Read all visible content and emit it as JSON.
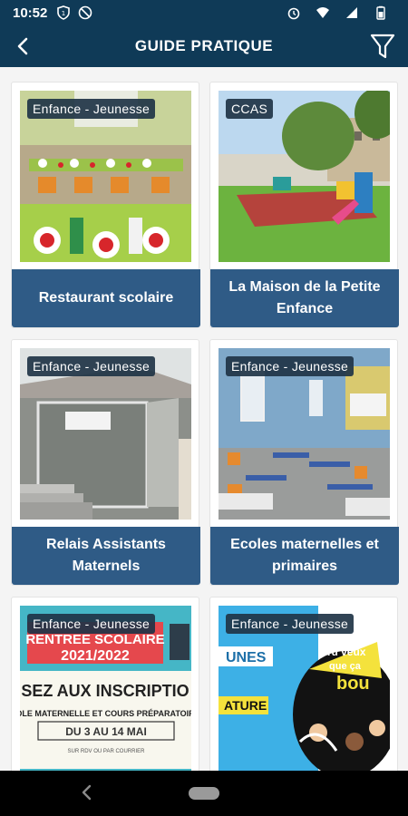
{
  "status_bar": {
    "time": "10:52"
  },
  "app_bar": {
    "title": "GUIDE PRATIQUE"
  },
  "cards": [
    {
      "tag": "Enfance - Jeunesse",
      "title": "Restaurant scolaire"
    },
    {
      "tag": "CCAS",
      "title": "La Maison de la Petite Enfance"
    },
    {
      "tag": "Enfance - Jeunesse",
      "title": "Relais Assistants Maternels"
    },
    {
      "tag": "Enfance - Jeunesse",
      "title": "Ecoles maternelles et primaires"
    },
    {
      "tag": "Enfance - Jeunesse",
      "title": ""
    },
    {
      "tag": "Enfance - Jeunesse",
      "title": ""
    }
  ],
  "flyer_1": {
    "line1": "RENTREE SCOLAIRE",
    "line2": "2021/2022",
    "line3": "SEZ AUX INSCRIPTIO",
    "line4": "OLE MATERNELLE ET COURS PRÉPARATOIR",
    "line5": "DU 3 AU 14 MAI",
    "line6": "SUR RDV OU PAR COURRIER"
  },
  "flyer_2": {
    "line1": "UNES",
    "line2": "ATURE",
    "line3": "Tu veux",
    "line4": "que ça",
    "line5": "bou"
  },
  "colors": {
    "header": "#0f3a57",
    "label_bg": "#2f5b86"
  }
}
